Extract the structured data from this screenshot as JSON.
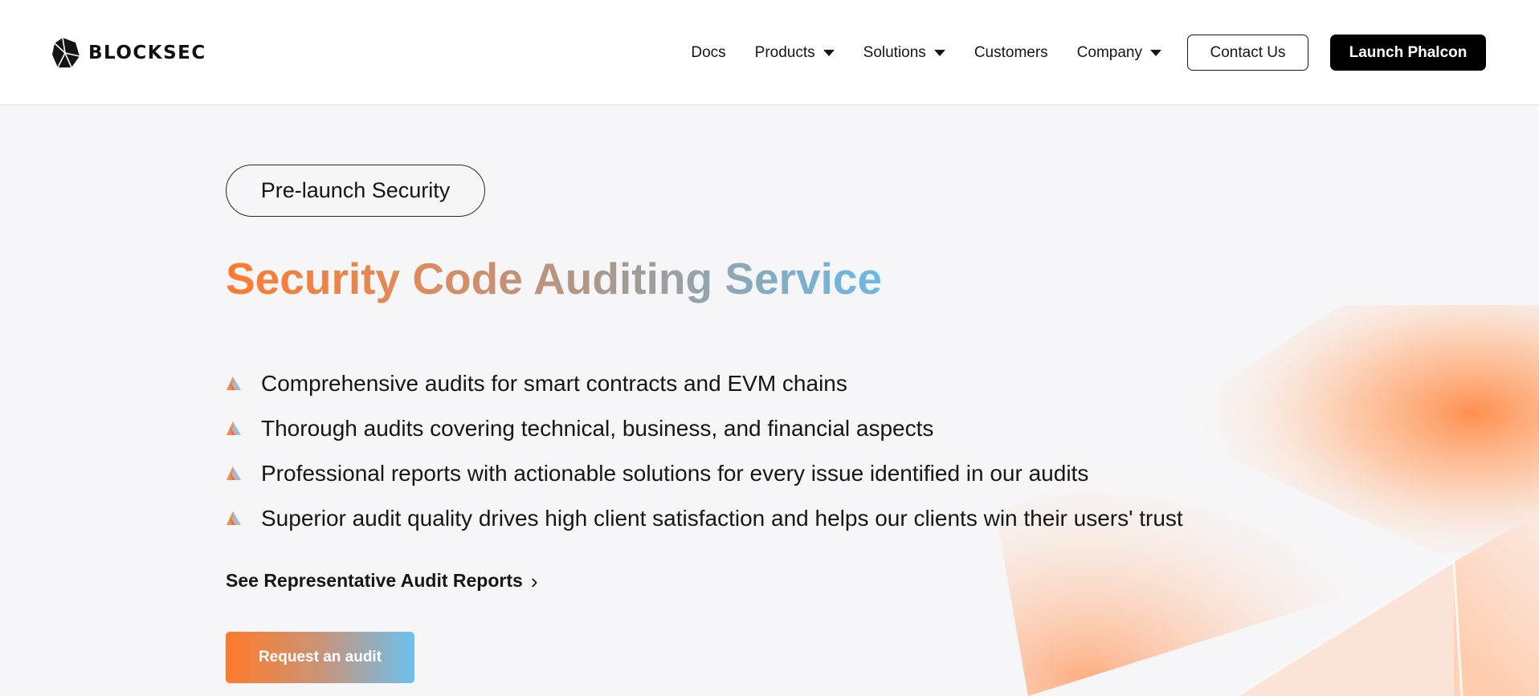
{
  "header": {
    "logo_text": "BLOCKSEC",
    "nav": {
      "docs": "Docs",
      "products": "Products",
      "solutions": "Solutions",
      "customers": "Customers",
      "company": "Company"
    },
    "contact_label": "Contact Us",
    "launch_label": "Launch Phalcon"
  },
  "hero": {
    "badge": "Pre-launch Security",
    "title": "Security Code Auditing Service",
    "features": [
      "Comprehensive audits for smart contracts and EVM chains",
      "Thorough audits covering technical, business, and financial aspects",
      "Professional reports with actionable solutions for every issue identified in our audits",
      "Superior audit quality drives high client satisfaction and helps our clients win their users' trust"
    ],
    "reports_link": "See Representative Audit Reports",
    "cta_label": "Request an audit"
  },
  "colors": {
    "brand_orange": "#ff7a2f",
    "brand_blue": "#6bb9e6",
    "button_dark": "#000000",
    "background": "#f6f6f8"
  },
  "icons": {
    "logo": "blocksec-polyhedron-logo",
    "dropdown": "caret-down-icon",
    "bullet": "triangle-bullet-icon",
    "link_arrow": "chevron-right-icon"
  }
}
